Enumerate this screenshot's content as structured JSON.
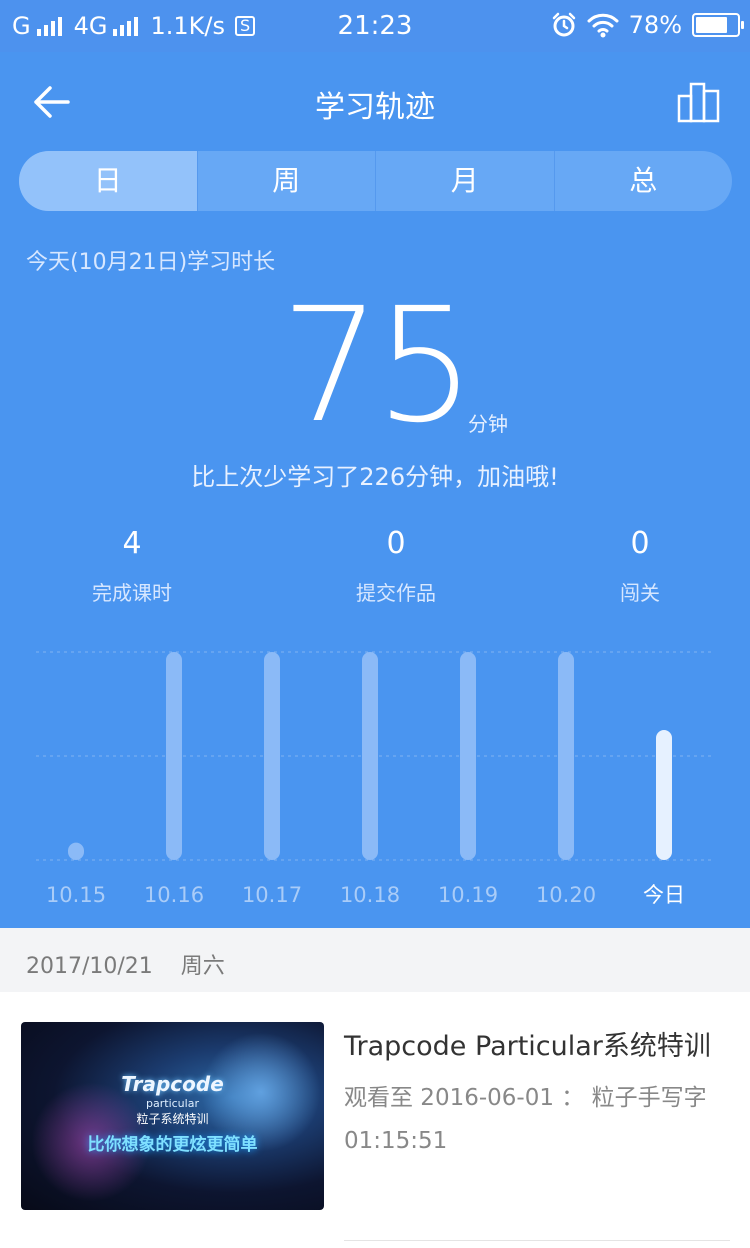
{
  "status_bar": {
    "carrier1": "G",
    "carrier2": "4G",
    "speed": "1.1K/s",
    "s_badge": "S",
    "time": "21:23",
    "battery": "78%",
    "battery_level": 0.78,
    "icons": [
      "signal-icon",
      "signal-icon",
      "alarm-icon",
      "wifi-icon",
      "battery-icon"
    ]
  },
  "header": {
    "title": "学习轨迹",
    "back_icon": "back-arrow-icon",
    "right_icon": "bar-chart-icon"
  },
  "tabs": [
    {
      "label": "日",
      "active": true
    },
    {
      "label": "周",
      "active": false
    },
    {
      "label": "月",
      "active": false
    },
    {
      "label": "总",
      "active": false
    }
  ],
  "summary": {
    "subtitle": "今天(10月21日)学习时长",
    "minutes": "75",
    "unit": "分钟",
    "comparison": "比上次少学习了226分钟，加油哦!"
  },
  "stats": [
    {
      "value": "4",
      "label": "完成课时"
    },
    {
      "value": "0",
      "label": "提交作品"
    },
    {
      "value": "0",
      "label": "闯关"
    }
  ],
  "chart_data": {
    "type": "bar",
    "categories": [
      "10.15",
      "10.16",
      "10.17",
      "10.18",
      "10.19",
      "10.20",
      "今日"
    ],
    "values": [
      10,
      120,
      120,
      120,
      120,
      120,
      75
    ],
    "ylim": [
      0,
      120
    ],
    "grid": true,
    "highlight_index": 6,
    "colors": {
      "bar": "#8bbaf7",
      "highlight": "#e6f1ff",
      "grid": "#80b3f2",
      "label": "#a9ccf8",
      "label_highlight": "#ffffff"
    }
  },
  "record": {
    "date": "2017/10/21",
    "weekday": "周六",
    "course": {
      "title": "Trapcode Particular系统特训",
      "progress": "观看至 2016-06-01 ： 粒子手写字",
      "time": "01:15:51",
      "thumb_title": "Trapcode",
      "thumb_sub": "particular",
      "thumb_cn": "粒子系统特训",
      "thumb_slogan": "比你想象的更炫更简单"
    }
  },
  "colors": {
    "primary": "#4a95f0",
    "tab_active": "#93c2fa",
    "tab_bg": "#67a8f5"
  }
}
